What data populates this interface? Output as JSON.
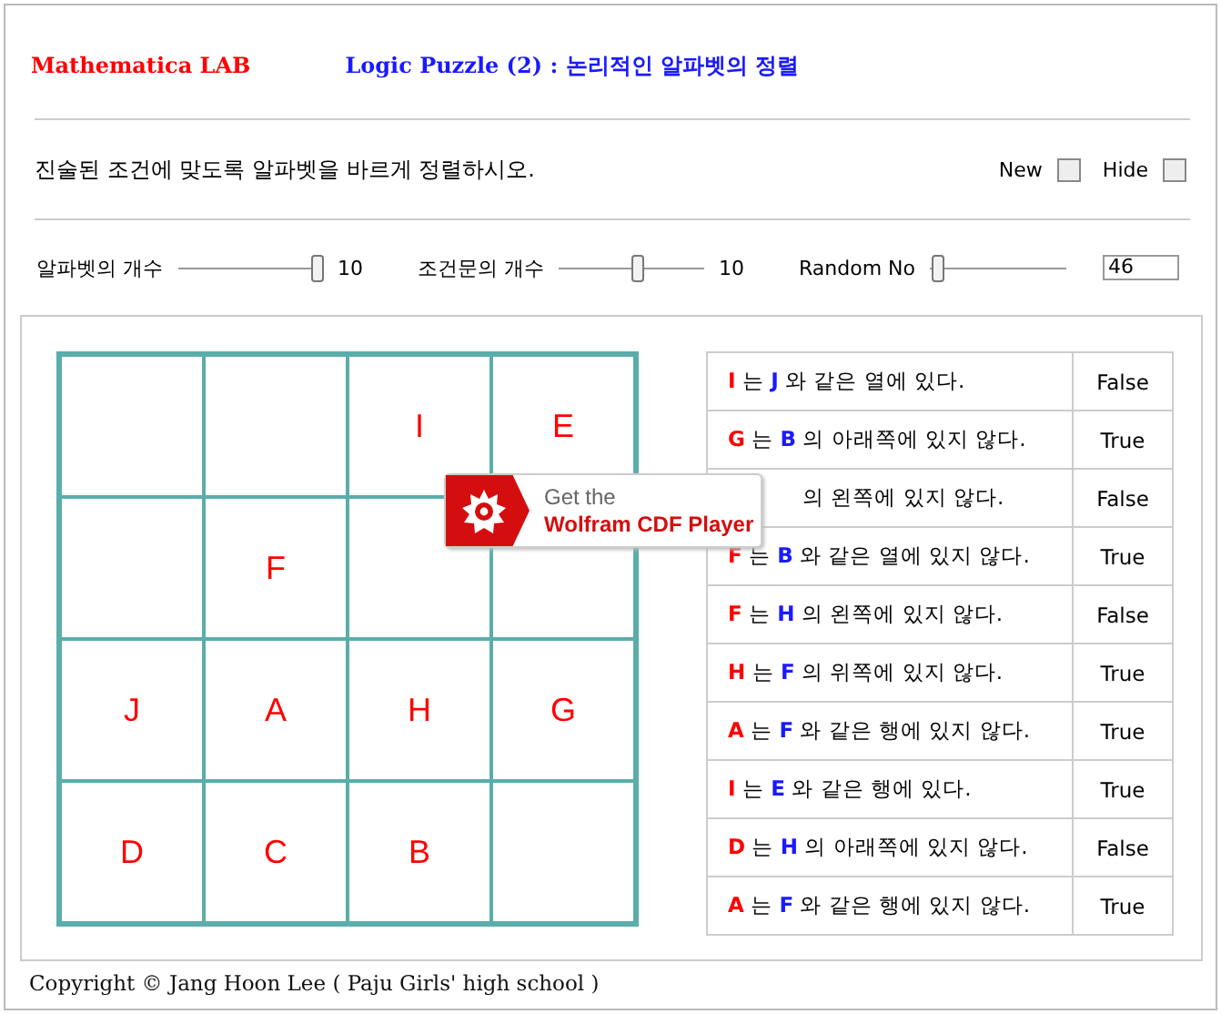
{
  "header": {
    "brand": "Mathematica LAB",
    "title": "Logic Puzzle (2) : 논리적인 알파벳의 정렬"
  },
  "instruction": "진술된 조건에 맞도록 알파벳을 바르게 정렬하시오.",
  "checkboxes": [
    {
      "label": "New",
      "checked": false
    },
    {
      "label": "Hide",
      "checked": false
    }
  ],
  "sliders": [
    {
      "label": "알파벳의 개수",
      "level": 1,
      "reading": "10"
    },
    {
      "label": "조건문의 개수",
      "level": 0.55,
      "reading": "10"
    },
    {
      "label": "Random No",
      "level": 0.02
    }
  ],
  "random_field": {
    "value": "46"
  },
  "grid": [
    {
      "kind": "empty"
    },
    {
      "kind": "empty"
    },
    {
      "kind": "letter",
      "letter": "I"
    },
    {
      "kind": "letter",
      "letter": "E"
    },
    {
      "kind": "empty"
    },
    {
      "kind": "letter",
      "letter": "F"
    },
    {
      "kind": "empty"
    },
    {
      "kind": "empty"
    },
    {
      "kind": "letter",
      "letter": "J"
    },
    {
      "kind": "letter",
      "letter": "A"
    },
    {
      "kind": "letter",
      "letter": "H"
    },
    {
      "kind": "letter",
      "letter": "G"
    },
    {
      "kind": "letter",
      "letter": "D"
    },
    {
      "kind": "letter",
      "letter": "C"
    },
    {
      "kind": "letter",
      "letter": "B"
    },
    {
      "kind": "empty"
    }
  ],
  "conditions": [
    {
      "subject": "I",
      "particle": "는",
      "object": "J",
      "text": "와 같은 열에 있다.",
      "result": "False"
    },
    {
      "subject": "G",
      "particle": "는",
      "object": "B",
      "text": "의 아래쪽에 있지 않다.",
      "result": "True"
    },
    {
      "text": "의 왼쪽에 있지 않다.",
      "result": "False"
    },
    {
      "subject": "F",
      "particle": "는",
      "object": "B",
      "text": "와 같은 열에 있지 않다.",
      "result": "True"
    },
    {
      "subject": "F",
      "particle": "는",
      "object": "H",
      "text": "의 왼쪽에 있지 않다.",
      "result": "False"
    },
    {
      "subject": "H",
      "particle": "는",
      "object": "F",
      "text": "의 위쪽에 있지 않다.",
      "result": "True"
    },
    {
      "subject": "A",
      "particle": "는",
      "object": "F",
      "text": "와 같은 행에 있지 않다.",
      "result": "True"
    },
    {
      "subject": "I",
      "particle": "는",
      "object": "E",
      "text": "와 같은 행에 있다.",
      "result": "True"
    },
    {
      "subject": "D",
      "particle": "는",
      "object": "H",
      "text": "의 아래쪽에 있지 않다.",
      "result": "False"
    },
    {
      "subject": "A",
      "particle": "는",
      "object": "F",
      "text": "와 같은 행에 있지 않다.",
      "result": "True"
    }
  ],
  "cdf_badge": {
    "line1": "Get the",
    "line2": "Wolfram CDF Player"
  },
  "footer": "Copyright © Jang Hoon Lee ( Paju Girls' high school )"
}
